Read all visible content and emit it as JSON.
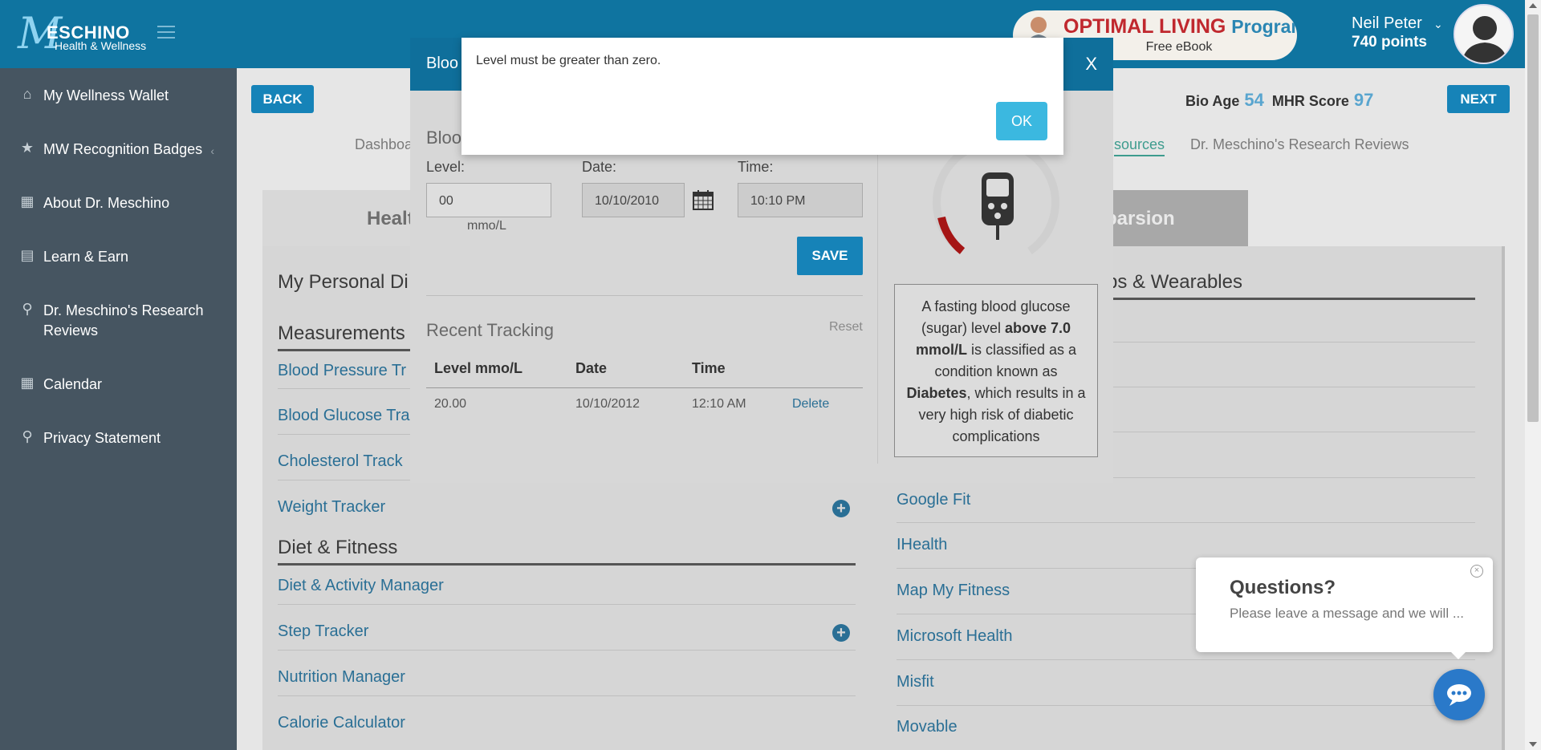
{
  "header": {
    "logo_name": "ESCHINO",
    "logo_sub": "Health & Wellness",
    "promo_title": "OPTIMAL LIVING",
    "promo_program": "Program",
    "promo_sub": "Free eBook",
    "user_name": "Neil Peter",
    "user_points": "740 points"
  },
  "sidebar": {
    "items": [
      {
        "label": "My Wellness Wallet",
        "icon": "home-icon"
      },
      {
        "label": "MW Recognition Badges",
        "icon": "trophy-icon"
      },
      {
        "label": "About Dr. Meschino",
        "icon": "book-icon"
      },
      {
        "label": "Learn & Earn",
        "icon": "open-book-icon"
      },
      {
        "label": "Dr. Meschino's Research Reviews",
        "icon": "search-icon"
      },
      {
        "label": "Calendar",
        "icon": "calendar-icon"
      },
      {
        "label": "Privacy Statement",
        "icon": "key-icon"
      }
    ]
  },
  "toolbar": {
    "back_label": "BACK",
    "next_label": "NEXT",
    "bio_age_label": "Bio Age",
    "bio_age_value": "54",
    "mhr_label": "MHR Score",
    "mhr_value": "97"
  },
  "subnav": {
    "dashboard": "Dashboa",
    "resources": "sources",
    "research": "Dr. Meschino's Research Reviews"
  },
  "tabs": {
    "left": "Health",
    "right": "parsion"
  },
  "left_col": {
    "personal_head": "My Personal Di",
    "measurements_head": "Measurements",
    "rows": [
      "Blood Pressure Tr",
      "Blood Glucose Tra",
      "Cholesterol Track",
      "Weight Tracker"
    ],
    "diet_head": "Diet & Fitness",
    "diet_rows": [
      "Diet & Activity Manager",
      "Step Tracker",
      "Nutrition Manager",
      "Calorie Calculator"
    ]
  },
  "right_col": {
    "head": "ps & Wearables",
    "rows": [
      "Google Fit",
      "IHealth",
      "Map My Fitness",
      "Microsoft Health",
      "Misfit",
      "Movable"
    ]
  },
  "glucose_modal": {
    "title": "Bloo",
    "close": "X",
    "section_title": "Bloo",
    "level_label": "Level:",
    "level_value": "00",
    "level_unit": "mmo/L",
    "date_label": "Date:",
    "date_value": "10/10/2010",
    "time_label": "Time:",
    "time_value": "10:10 PM",
    "save_label": "SAVE",
    "recent_title": "Recent Tracking",
    "reset_label": "Reset",
    "table_headers": [
      "Level mmo/L",
      "Date",
      "Time"
    ],
    "rows": [
      {
        "level": "20.00",
        "date": "10/10/2012",
        "time": "12:10 AM",
        "action": "Delete"
      }
    ],
    "info_pre": "A fasting blood glucose (sugar) level ",
    "info_bold1": "above 7.0 mmol/L",
    "info_mid": " is classified as a condition known as ",
    "info_bold2": "Diabetes",
    "info_post": ", which results in a very high risk of diabetic complications"
  },
  "alert": {
    "message": "Level must be greater than zero.",
    "ok_label": "OK"
  },
  "chat": {
    "title": "Questions?",
    "subtitle": "Please leave a message and we will ..."
  },
  "colors": {
    "header_blue": "#0f74a0",
    "sidebar_gray": "#465561",
    "button_blue": "#1683b8",
    "ok_blue": "#3bb8e0",
    "link_blue": "#2a6f95",
    "promo_red": "#c0282e"
  }
}
